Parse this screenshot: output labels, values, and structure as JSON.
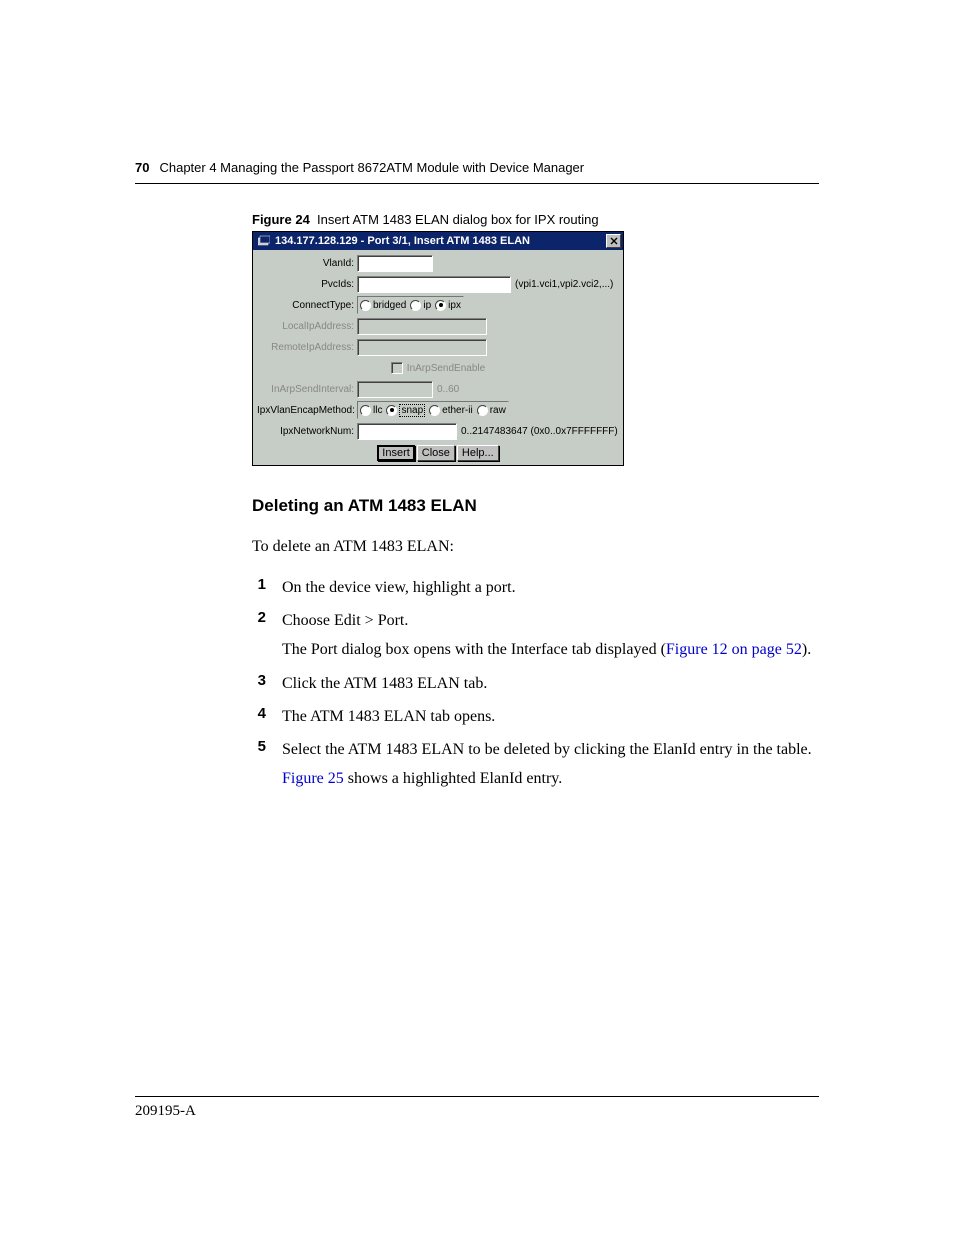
{
  "header": {
    "page_number": "70",
    "chapter_text": "Chapter 4  Managing the Passport 8672ATM Module with Device Manager"
  },
  "figure": {
    "label": "Figure 24",
    "caption": "Insert ATM 1483 ELAN dialog box for IPX routing"
  },
  "dialog": {
    "title": "134.177.128.129 - Port 3/1, Insert ATM 1483 ELAN",
    "vlanid_label": "VlanId:",
    "pvcids_label": "PvcIds:",
    "pvcids_hint": "(vpi1.vci1,vpi2.vci2,...)",
    "connecttype_label": "ConnectType:",
    "connecttype_options": {
      "bridged": "bridged",
      "ip": "ip",
      "ipx": "ipx"
    },
    "localip_label": "LocalIpAddress:",
    "remoteip_label": "RemoteIpAddress:",
    "inarpsendenable_label": "InArpSendEnable",
    "inarpsendinterval_label": "InArpSendInterval:",
    "inarpsendinterval_hint": "0..60",
    "ipxvlanencap_label": "IpxVlanEncapMethod:",
    "ipxvlanencap_options": {
      "llc": "llc",
      "snap": "snap",
      "etherii": "ether-ii",
      "raw": "raw"
    },
    "ipxnetworknum_label": "IpxNetworkNum:",
    "ipxnetworknum_hint": "0..2147483647 (0x0..0x7FFFFFFF)",
    "buttons": {
      "insert": "Insert",
      "close": "Close",
      "help": "Help..."
    }
  },
  "section": {
    "heading": "Deleting an ATM 1483 ELAN",
    "intro": "To delete an ATM 1483 ELAN:",
    "steps": [
      {
        "text": "On the device view, highlight a port."
      },
      {
        "text": "Choose Edit > Port.",
        "sub_pre": "The Port dialog box opens with the Interface tab displayed (",
        "sub_link": "Figure 12 on page 52",
        "sub_post": ")."
      },
      {
        "text": "Click the ATM 1483 ELAN tab."
      },
      {
        "text": "The ATM 1483 ELAN tab opens."
      },
      {
        "text": "Select the ATM 1483 ELAN to be deleted by clicking the ElanId entry in the table.",
        "sub_link": "Figure 25",
        "sub_post": " shows a highlighted ElanId entry."
      }
    ]
  },
  "footer": {
    "doc_id": "209195-A"
  }
}
